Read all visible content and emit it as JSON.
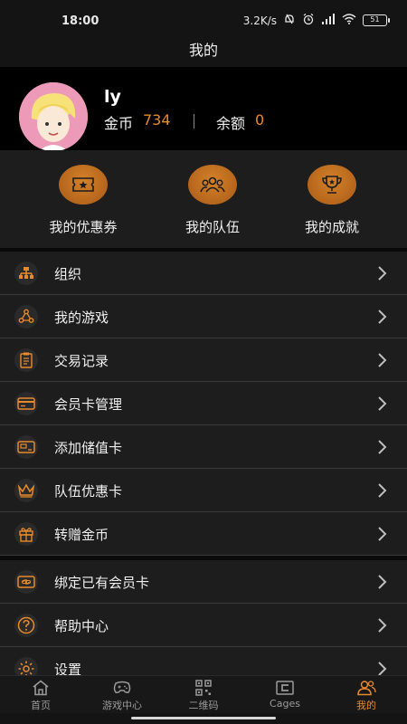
{
  "status_bar": {
    "time": "18:00",
    "net_speed": "3.2K/s",
    "battery": "51"
  },
  "header": {
    "title": "我的"
  },
  "profile": {
    "username": "ly",
    "coins_label": "金币",
    "coins_value": "734",
    "balance_label": "余额",
    "balance_value": "0"
  },
  "shortcuts": [
    {
      "label": "我的优惠券",
      "icon": "coupon-icon"
    },
    {
      "label": "我的队伍",
      "icon": "team-icon"
    },
    {
      "label": "我的成就",
      "icon": "trophy-icon"
    }
  ],
  "menu_group1": [
    {
      "label": "组织",
      "icon": "organization-icon"
    },
    {
      "label": "我的游戏",
      "icon": "games-icon"
    },
    {
      "label": "交易记录",
      "icon": "transaction-record-icon"
    },
    {
      "label": "会员卡管理",
      "icon": "membership-card-icon"
    },
    {
      "label": "添加储值卡",
      "icon": "stored-value-card-icon"
    },
    {
      "label": "队伍优惠卡",
      "icon": "crown-icon"
    },
    {
      "label": "转赠金币",
      "icon": "gift-icon"
    }
  ],
  "menu_group2": [
    {
      "label": "绑定已有会员卡",
      "icon": "bind-card-icon"
    },
    {
      "label": "帮助中心",
      "icon": "help-icon"
    },
    {
      "label": "设置",
      "icon": "settings-icon"
    }
  ],
  "tabs": [
    {
      "label": "首页",
      "icon": "home-icon",
      "active": false
    },
    {
      "label": "游戏中心",
      "icon": "game-center-icon",
      "active": false
    },
    {
      "label": "二维码",
      "icon": "qr-code-icon",
      "active": false
    },
    {
      "label": "Cages",
      "icon": "cages-icon",
      "active": false
    },
    {
      "label": "我的",
      "icon": "profile-icon",
      "active": true
    }
  ],
  "colors": {
    "accent": "#e98a2a",
    "background": "#1d1d1d",
    "profile_background": "#000000"
  }
}
